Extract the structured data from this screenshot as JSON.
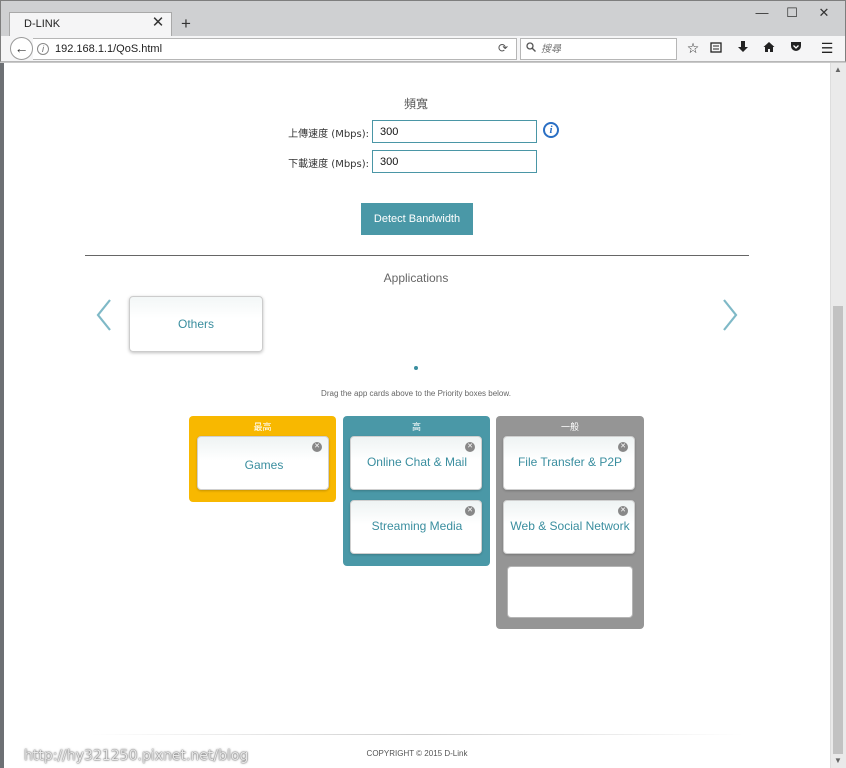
{
  "browser": {
    "tab_title": "D-LINK",
    "close_tab": "✕",
    "new_tab": "+",
    "win_minimize": "—",
    "win_maximize": "☐",
    "win_close": "✕",
    "url": "192.168.1.1/QoS.html",
    "search_placeholder": "搜尋",
    "icons": [
      "back-arrow-icon",
      "info-icon",
      "reload-icon",
      "search-icon",
      "bookmark-star-icon",
      "reading-list-icon",
      "download-icon",
      "home-icon",
      "pocket-icon",
      "menu-icon"
    ]
  },
  "bandwidth": {
    "title": "頻寬",
    "upload_label": "上傳速度 (Mbps):",
    "upload_value": "300",
    "download_label": "下載速度 (Mbps):",
    "download_value": "300",
    "detect_button": "Detect Bandwidth"
  },
  "applications": {
    "title": "Applications",
    "available_cards": [
      {
        "label": "Others"
      }
    ],
    "drag_hint": "Drag the app cards above to the Priority boxes below."
  },
  "priority": {
    "highest": {
      "title": "最高",
      "color": "#f8b800",
      "apps": [
        "Games"
      ]
    },
    "high": {
      "title": "高",
      "color": "#4a98a7",
      "apps": [
        "Online Chat & Mail",
        "Streaming Media"
      ]
    },
    "normal": {
      "title": "一般",
      "color": "#959595",
      "apps": [
        "File Transfer & P2P",
        "Web & Social Network"
      ]
    }
  },
  "footer": {
    "copyright": "COPYRIGHT © 2015 D-Link"
  },
  "watermark": "http://hy321250.pixnet.net/blog"
}
